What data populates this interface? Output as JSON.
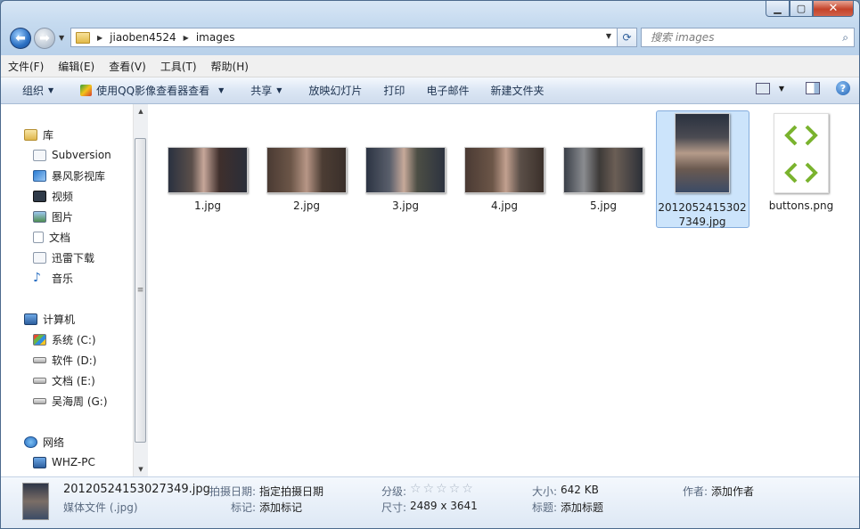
{
  "window": {
    "minimize": "▁",
    "maximize": "▢",
    "close": "✕"
  },
  "nav": {
    "back": "⬅",
    "forward": "➡",
    "path": [
      "jiaoben4524",
      "images"
    ],
    "search_placeholder": "搜索 images"
  },
  "menu": [
    "文件(F)",
    "编辑(E)",
    "查看(V)",
    "工具(T)",
    "帮助(H)"
  ],
  "commands": {
    "organize": "组织",
    "open_with": "使用QQ影像查看器查看",
    "share": "共享",
    "slideshow": "放映幻灯片",
    "print": "打印",
    "email": "电子邮件",
    "new_folder": "新建文件夹"
  },
  "sidebar": {
    "library": {
      "label": "库",
      "items": [
        "Subversion",
        "暴风影视库",
        "视频",
        "图片",
        "文档",
        "迅雷下载",
        "音乐"
      ]
    },
    "computer": {
      "label": "计算机",
      "items": [
        "系统 (C:)",
        "软件 (D:)",
        "文档 (E:)",
        "吴海周 (G:)"
      ]
    },
    "network": {
      "label": "网络",
      "items": [
        "WHZ-PC"
      ]
    }
  },
  "files": [
    {
      "name": "1.jpg"
    },
    {
      "name": "2.jpg"
    },
    {
      "name": "3.jpg"
    },
    {
      "name": "4.jpg"
    },
    {
      "name": "5.jpg"
    },
    {
      "name": "20120524153027349.jpg",
      "label_line1": "2012052415302",
      "label_line2": "7349.jpg",
      "selected": true
    },
    {
      "name": "buttons.png",
      "accent": "#7ab32e"
    }
  ],
  "details": {
    "filename": "20120524153027349.jpg",
    "filetype": "媒体文件 (.jpg)",
    "date_taken_key": "拍摄日期:",
    "date_taken_val": "指定拍摄日期",
    "tags_key": "标记:",
    "tags_val": "添加标记",
    "rating_key": "分级:",
    "rating_stars": "☆☆☆☆☆",
    "dimensions_key": "尺寸:",
    "dimensions_val": "2489 x 3641",
    "size_key": "大小:",
    "size_val": "642 KB",
    "title_key": "标题:",
    "title_val": "添加标题",
    "author_key": "作者:",
    "author_val": "添加作者"
  }
}
